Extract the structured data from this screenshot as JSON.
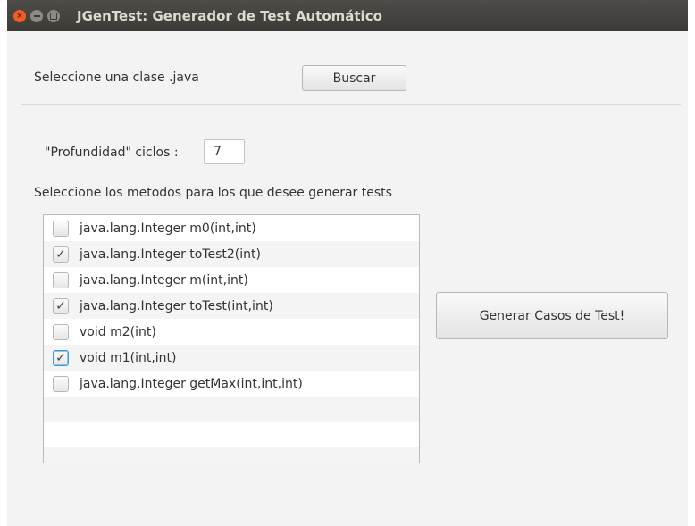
{
  "window": {
    "title": "JGenTest: Generador de Test Automático"
  },
  "class_selector": {
    "label": "Seleccione una clase .java",
    "browse_label": "Buscar"
  },
  "depth": {
    "label": "\"Profundidad\" ciclos :",
    "value": "7"
  },
  "methods": {
    "heading": "Seleccione los metodos para los que desee generar tests",
    "items": [
      {
        "label": "java.lang.Integer m0(int,int)",
        "checked": false,
        "mark": ""
      },
      {
        "label": "java.lang.Integer toTest2(int)",
        "checked": true,
        "mark": "✓"
      },
      {
        "label": "java.lang.Integer m(int,int)",
        "checked": false,
        "mark": ""
      },
      {
        "label": "java.lang.Integer toTest(int,int)",
        "checked": true,
        "mark": "✓"
      },
      {
        "label": "void m2(int)",
        "checked": false,
        "mark": ""
      },
      {
        "label": "void m1(int,int)",
        "checked": true,
        "mark": "✓"
      },
      {
        "label": "java.lang.Integer getMax(int,int,int)",
        "checked": false,
        "mark": ""
      }
    ]
  },
  "actions": {
    "generate_label": "Generar Casos de Test!"
  }
}
